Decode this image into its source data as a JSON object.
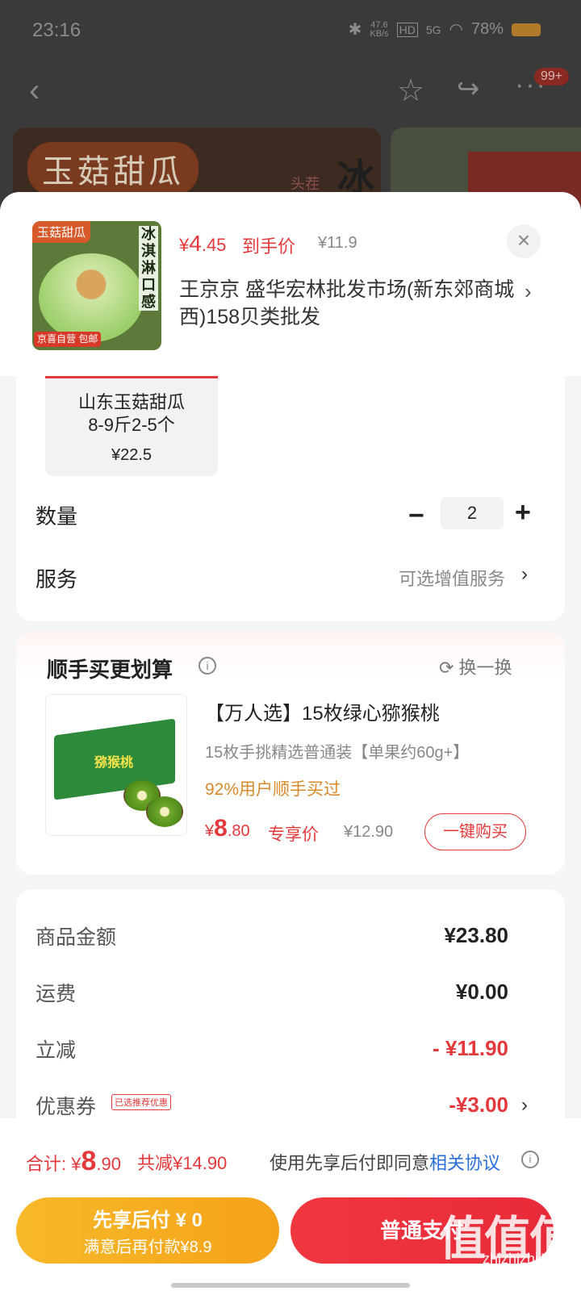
{
  "status": {
    "time": "23:16",
    "net_speed": "47.6",
    "net_unit": "KB/s",
    "hd": "HD",
    "signal": "5G",
    "battery": "78%"
  },
  "nav": {
    "badge": "99+"
  },
  "banner": {
    "title": "玉菇甜瓜",
    "ice": "冰",
    "tou": "头茬"
  },
  "product": {
    "thumb_tag": "玉菇甜瓜",
    "thumb_side": "冰淇淋口感",
    "thumb_badge": "京喜自营 包邮",
    "price_symbol": "¥",
    "price_big": "4",
    "price_small": ".45",
    "price_label": "到手价",
    "orig_price": "¥11.9",
    "close": "×",
    "address": "王京京  盛华宏林批发市场(新东郊商城西)158贝类批发",
    "address_arrow": "›"
  },
  "sku": {
    "name_line1": "山东玉菇甜瓜",
    "name_line2": "8-9斤2-5个",
    "price": "¥22.5"
  },
  "quantity": {
    "label": "数量",
    "minus": "−",
    "value": "2",
    "plus": "+"
  },
  "service": {
    "label": "服务",
    "value": "可选增值服务",
    "arrow": "›"
  },
  "addon": {
    "title": "顺手买更划算",
    "info": "i",
    "swap": "⟳ 换一换",
    "box_text": "猕猴桃",
    "item_title": "【万人选】15枚绿心猕猴桃",
    "item_sub": "15枚手挑精选普通装【单果约60g+】",
    "item_tip": "92%用户顺手买过",
    "price_symbol": "¥",
    "price_big": "8",
    "price_small": ".80",
    "price_label": "专享价",
    "orig_price": "¥12.90",
    "buy": "一键购买"
  },
  "summary": {
    "goods_label": "商品金额",
    "goods_value": "¥23.80",
    "freight_label": "运费",
    "freight_value": "¥0.00",
    "discount_label": "立减",
    "discount_value": "- ¥11.90",
    "coupon_label": "优惠券",
    "coupon_tag": "已选推荐优惠",
    "coupon_value": "-¥3.00",
    "coupon_arrow": "›"
  },
  "footer": {
    "total_prefix": "合计: ¥",
    "total_big": "8",
    "total_small": ".90",
    "reduce": "共减¥14.90",
    "agree_text": "使用先享后付即同意",
    "agree_link": "相关协议",
    "agree_icon": "i",
    "pay_later_l1": "先享后付 ¥ 0",
    "pay_later_l2": "满意后再付款¥8.9",
    "pay_normal": "普通支付"
  },
  "watermark": {
    "main": "值值值",
    "sub": "zhizhizhi.com"
  },
  "colors": {
    "accent": "#e4393c",
    "pay_later": "#f5a21a",
    "link": "#2a6fd8",
    "tip": "#d88a2a"
  }
}
